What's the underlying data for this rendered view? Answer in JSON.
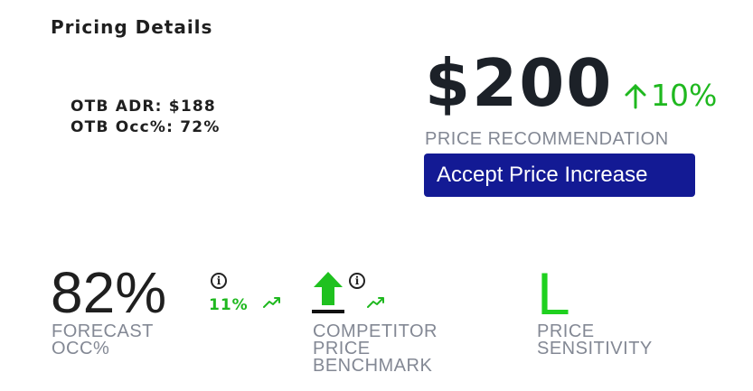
{
  "header": {
    "title": "Pricing Details"
  },
  "otb": {
    "adr": "OTB ADR: $188",
    "occ": "OTB Occ%: 72%"
  },
  "recommendation": {
    "price": "$200",
    "change": "10%",
    "label": "PRICE RECOMMENDATION",
    "button_label": "Accept Price Increase"
  },
  "metrics": {
    "forecast": {
      "value": "82%",
      "change": "11%",
      "label_line1": "FORECAST",
      "label_line2": "OCC%"
    },
    "competitor": {
      "label_line1": "COMPETITOR",
      "label_line2": "PRICE",
      "label_line3": "BENCHMARK"
    },
    "sensitivity": {
      "value": "L",
      "label_line1": "PRICE",
      "label_line2": "SENSITIVITY"
    }
  },
  "icons": [
    "arrow-up-icon",
    "info-icon",
    "trend-up-icon",
    "thick-up-arrow-icon"
  ],
  "colors": {
    "accent_green": "#1fb81f",
    "button_blue": "#131a94",
    "label_gray": "#838894",
    "sensitivity_green": "#1fd11f"
  }
}
